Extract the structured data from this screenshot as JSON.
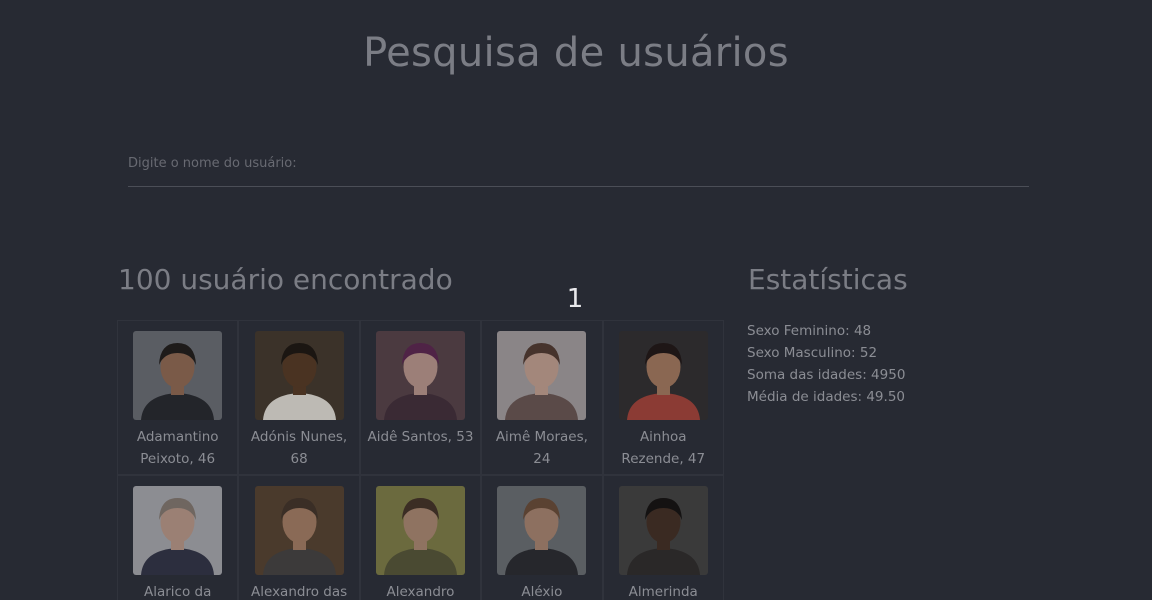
{
  "header": {
    "title": "Pesquisa de usuários"
  },
  "search": {
    "placeholder": "Digite o nome do usuário:",
    "value": ""
  },
  "results": {
    "title": "100 usuário encontrado",
    "loader_text": "1"
  },
  "stats": {
    "title": "Estatísticas",
    "items": [
      "Sexo Feminino: 48",
      "Sexo Masculino: 52",
      "Soma das idades: 4950",
      "Média de idades: 49.50"
    ]
  },
  "users": [
    {
      "name": "Adamantino Peixoto, 46",
      "bg": "#5a5d63",
      "skin": "#7a5a48",
      "hair": "#1e1b1a",
      "cloth": "#23252a"
    },
    {
      "name": "Adónis Nunes, 68",
      "bg": "#3b3229",
      "skin": "#4a3322",
      "hair": "#1b1612",
      "cloth": "#bdbab4"
    },
    {
      "name": "Aidê Santos, 53",
      "bg": "#4b3a40",
      "skin": "#9c7f78",
      "hair": "#4f2346",
      "cloth": "#3a2a34"
    },
    {
      "name": "Aimê Moraes, 24",
      "bg": "#8a8587",
      "skin": "#a3877b",
      "hair": "#46332c",
      "cloth": "#5a4a48"
    },
    {
      "name": "Ainhoa Rezende, 47",
      "bg": "#2c2a2c",
      "skin": "#8a6752",
      "hair": "#1e1616",
      "cloth": "#8b3b34"
    },
    {
      "name": "Alarico da",
      "bg": "#8c8d92",
      "skin": "#9b8074",
      "hair": "#6f6660",
      "cloth": "#2c2e3e"
    },
    {
      "name": "Alexandro das",
      "bg": "#4a3a2c",
      "skin": "#8a6a56",
      "hair": "#3a2e26",
      "cloth": "#3c3a3a"
    },
    {
      "name": "Alexandro",
      "bg": "#6b6a3e",
      "skin": "#8f7361",
      "hair": "#3b2d24",
      "cloth": "#4a4a32"
    },
    {
      "name": "Aléxio",
      "bg": "#5a5e62",
      "skin": "#8d7060",
      "hair": "#5a4232",
      "cloth": "#26272c"
    },
    {
      "name": "Almerinda",
      "bg": "#3a3a3a",
      "skin": "#3a2a22",
      "hair": "#141212",
      "cloth": "#2a2828"
    }
  ]
}
